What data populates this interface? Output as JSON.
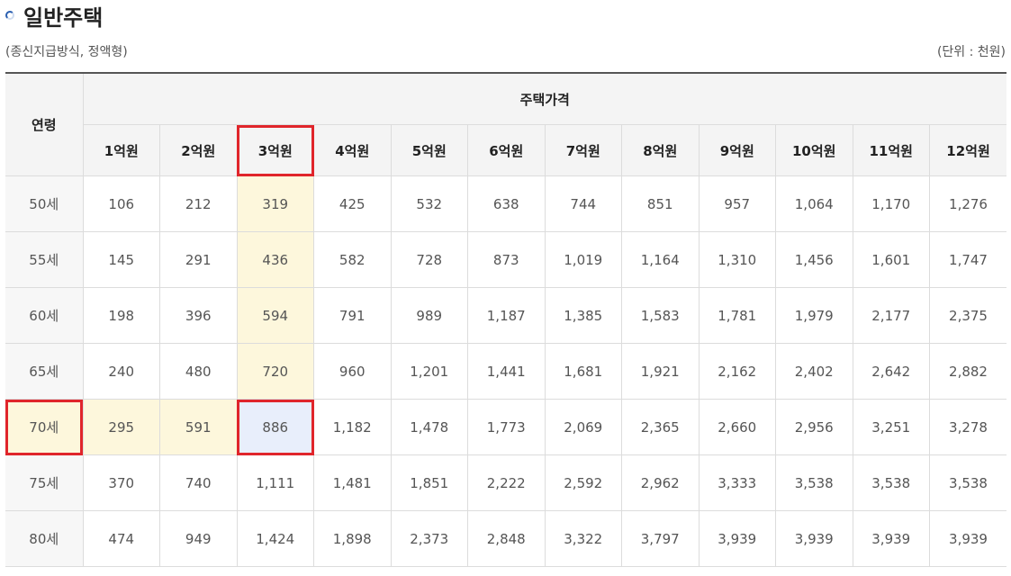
{
  "title": "일반주택",
  "subtitle_left": "(종신지급방식, 정액형)",
  "subtitle_right": "(단위 : 천원)",
  "table": {
    "age_header": "연령",
    "price_group_header": "주택가격",
    "columns": [
      "1억원",
      "2억원",
      "3억원",
      "4억원",
      "5억원",
      "6억원",
      "7억원",
      "8억원",
      "9억원",
      "10억원",
      "11억원",
      "12억원"
    ],
    "rows": [
      {
        "age": "50세",
        "values": [
          "106",
          "212",
          "319",
          "425",
          "532",
          "638",
          "744",
          "851",
          "957",
          "1,064",
          "1,170",
          "1,276"
        ]
      },
      {
        "age": "55세",
        "values": [
          "145",
          "291",
          "436",
          "582",
          "728",
          "873",
          "1,019",
          "1,164",
          "1,310",
          "1,456",
          "1,601",
          "1,747"
        ]
      },
      {
        "age": "60세",
        "values": [
          "198",
          "396",
          "594",
          "791",
          "989",
          "1,187",
          "1,385",
          "1,583",
          "1,781",
          "1,979",
          "2,177",
          "2,375"
        ]
      },
      {
        "age": "65세",
        "values": [
          "240",
          "480",
          "720",
          "960",
          "1,201",
          "1,441",
          "1,681",
          "1,921",
          "2,162",
          "2,402",
          "2,642",
          "2,882"
        ]
      },
      {
        "age": "70세",
        "values": [
          "295",
          "591",
          "886",
          "1,182",
          "1,478",
          "1,773",
          "2,069",
          "2,365",
          "2,660",
          "2,956",
          "3,251",
          "3,278"
        ]
      },
      {
        "age": "75세",
        "values": [
          "370",
          "740",
          "1,111",
          "1,481",
          "1,851",
          "2,222",
          "2,592",
          "2,962",
          "3,333",
          "3,538",
          "3,538",
          "3,538"
        ]
      },
      {
        "age": "80세",
        "values": [
          "474",
          "949",
          "1,424",
          "1,898",
          "2,373",
          "2,848",
          "3,322",
          "3,797",
          "3,939",
          "3,939",
          "3,939",
          "3,939"
        ]
      }
    ],
    "highlight": {
      "column_index": 2,
      "row_index": 4
    }
  },
  "colors": {
    "highlight_yellow": "#fdf7dc",
    "highlight_blue": "#e8eefb",
    "red_box": "#e0252b"
  }
}
